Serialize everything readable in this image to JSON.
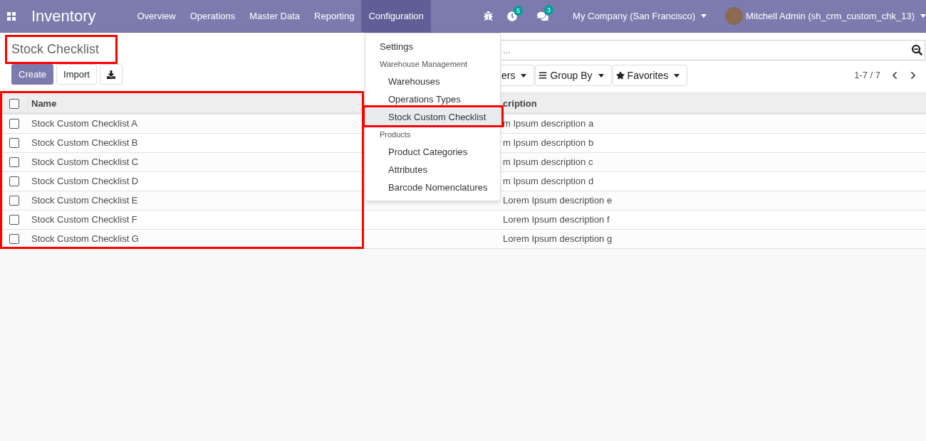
{
  "navbar": {
    "app_title": "Inventory",
    "menu": [
      {
        "label": "Overview",
        "selected": false
      },
      {
        "label": "Operations",
        "selected": false
      },
      {
        "label": "Master Data",
        "selected": false
      },
      {
        "label": "Reporting",
        "selected": false
      },
      {
        "label": "Configuration",
        "selected": true
      }
    ],
    "activity_count": "5",
    "message_count": "3",
    "company": "My Company (San Francisco)",
    "user": "Mitchell Admin (sh_crm_custom_chk_13)"
  },
  "breadcrumb": "Stock Checklist",
  "buttons": {
    "create": "Create",
    "import": "Import"
  },
  "search": {
    "placeholder": "..."
  },
  "filters": [
    {
      "kind": "filter",
      "label": "ers"
    },
    {
      "kind": "group",
      "label": "Group By"
    },
    {
      "kind": "favorite",
      "label": "Favorites"
    }
  ],
  "pager": "1-7 / 7",
  "table": {
    "columns": [
      "Name",
      "cription"
    ],
    "all_checked": false,
    "rows": [
      {
        "name": "Stock Custom Checklist A",
        "description": "m Ipsum description a",
        "checked": false
      },
      {
        "name": "Stock Custom Checklist B",
        "description": "m Ipsum description b",
        "checked": false
      },
      {
        "name": "Stock Custom Checklist C",
        "description": "m Ipsum description c",
        "checked": false
      },
      {
        "name": "Stock Custom Checklist D",
        "description": "m Ipsum description d",
        "checked": false
      },
      {
        "name": "Stock Custom Checklist E",
        "description": "Lorem Ipsum description e",
        "checked": false
      },
      {
        "name": "Stock Custom Checklist F",
        "description": "Lorem Ipsum description f",
        "checked": false
      },
      {
        "name": "Stock Custom Checklist G",
        "description": "Lorem Ipsum description g",
        "checked": false
      }
    ]
  },
  "dropdown": {
    "items": [
      {
        "kind": "item",
        "label": "Settings",
        "selected": false
      },
      {
        "kind": "header",
        "label": "Warehouse Management"
      },
      {
        "kind": "subitem",
        "label": "Warehouses",
        "selected": false
      },
      {
        "kind": "subitem",
        "label": "Operations Types",
        "selected": false
      },
      {
        "kind": "subitem",
        "label": "Stock Custom Checklist",
        "selected": true
      },
      {
        "kind": "header",
        "label": "Products"
      },
      {
        "kind": "subitem",
        "label": "Product Categories",
        "selected": false
      },
      {
        "kind": "subitem",
        "label": "Attributes",
        "selected": false
      },
      {
        "kind": "subitem",
        "label": "Barcode Nomenclatures",
        "selected": false
      }
    ]
  }
}
